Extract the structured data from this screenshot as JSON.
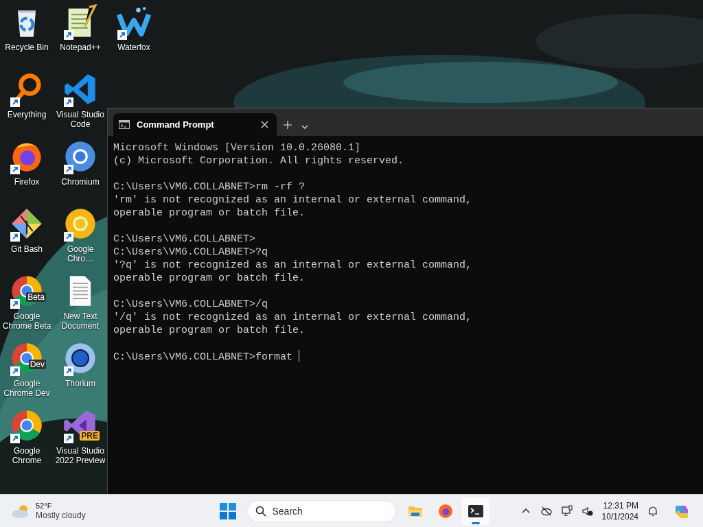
{
  "desktop": {
    "icons": [
      {
        "label": "Recycle Bin",
        "kind": "recycle",
        "shortcut": false
      },
      {
        "label": "Everything",
        "kind": "magnifier",
        "shortcut": true
      },
      {
        "label": "Firefox",
        "kind": "fox",
        "shortcut": true
      },
      {
        "label": "Git Bash",
        "kind": "diamond",
        "shortcut": true
      },
      {
        "label": "Google Chrome Beta",
        "kind": "tricolor",
        "shortcut": true,
        "badge": "Beta"
      },
      {
        "label": "Google Chrome Dev",
        "kind": "tricolor",
        "shortcut": true,
        "badge": "Dev"
      },
      {
        "label": "Google Chrome",
        "kind": "tricolor",
        "shortcut": true
      },
      {
        "label": "Notepad++",
        "kind": "notepad",
        "shortcut": true
      },
      {
        "label": "Visual Studio Code",
        "kind": "ribbon",
        "shortcut": true
      },
      {
        "label": "Chromium",
        "kind": "bluering",
        "shortcut": true
      },
      {
        "label": "Google Chro…",
        "kind": "yellowring",
        "shortcut": true
      },
      {
        "label": "New Text Document",
        "kind": "document",
        "shortcut": false
      },
      {
        "label": "Thorium",
        "kind": "darkring",
        "shortcut": true
      },
      {
        "label": "Visual Studio 2022 Preview",
        "kind": "purple",
        "shortcut": true,
        "badge": "PRE"
      },
      {
        "label": "Waterfox",
        "kind": "wave",
        "shortcut": true
      }
    ]
  },
  "terminal": {
    "tab": {
      "title": "Command Prompt",
      "selected": true
    },
    "blocks": [
      [
        "Microsoft Windows [Version 10.0.26080.1]",
        "(c) Microsoft Corporation. All rights reserved."
      ],
      [
        "C:\\Users\\VM6.COLLABNET>rm -rf ?",
        "'rm' is not recognized as an internal or external command,",
        "operable program or batch file."
      ],
      [
        "C:\\Users\\VM6.COLLABNET>",
        "C:\\Users\\VM6.COLLABNET>?q",
        "'?q' is not recognized as an internal or external command,",
        "operable program or batch file."
      ],
      [
        "C:\\Users\\VM6.COLLABNET>/q",
        "'/q' is not recognized as an internal or external command,",
        "operable program or batch file."
      ],
      [
        "C:\\Users\\VM6.COLLABNET>format"
      ]
    ],
    "cursor": true
  },
  "taskbar": {
    "weather": {
      "temperature": "52°F",
      "condition": "Mostly cloudy"
    },
    "search": {
      "placeholder": "Search"
    },
    "apps": [
      {
        "kind": "folder",
        "active": false
      },
      {
        "kind": "fox",
        "active": false
      },
      {
        "kind": "terminal",
        "active": true
      }
    ],
    "clock": {
      "time": "12:31 PM",
      "date": "10/1/2024"
    }
  }
}
